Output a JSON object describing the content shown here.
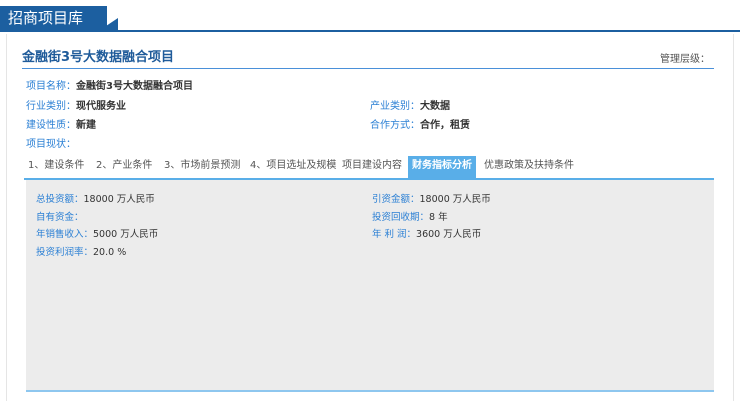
{
  "header": {
    "title": "招商项目库"
  },
  "project": {
    "title": "金融街3号大数据融合项目",
    "mgmt_label": "管理层级："
  },
  "info": {
    "name_label": "项目名称：",
    "name_value": "金融街3号大数据融合项目",
    "industry_label": "行业类别：",
    "industry_value": "现代服务业",
    "sector_label": "产业类别：",
    "sector_value": "大数据",
    "construction_label": "建设性质：",
    "construction_value": "新建",
    "cooperation_label": "合作方式：",
    "cooperation_value": "合作，租赁",
    "status_label": "项目现状：",
    "status_value": ""
  },
  "tabs": [
    "1、建设条件",
    "2、产业条件",
    "3、市场前景预测",
    "4、项目选址及规模",
    "项目建设内容",
    "财务指标分析",
    "优惠政策及扶持条件"
  ],
  "active_tab": 5,
  "finance": {
    "total_investment_label": "总投资额：",
    "total_investment_value": "18000 万人民币",
    "introduced_label": "引资金额：",
    "introduced_value": "18000 万人民币",
    "own_funds_label": "自有资金：",
    "own_funds_value": "",
    "payback_label": "投资回收期：",
    "payback_value": "8 年",
    "annual_sales_label": "年销售收入：",
    "annual_sales_value": "5000 万人民币",
    "annual_profit_label": "年 利 润：",
    "annual_profit_value": "3600 万人民币",
    "profit_rate_label": "投资利润率：",
    "profit_rate_value": "20.0 %"
  }
}
